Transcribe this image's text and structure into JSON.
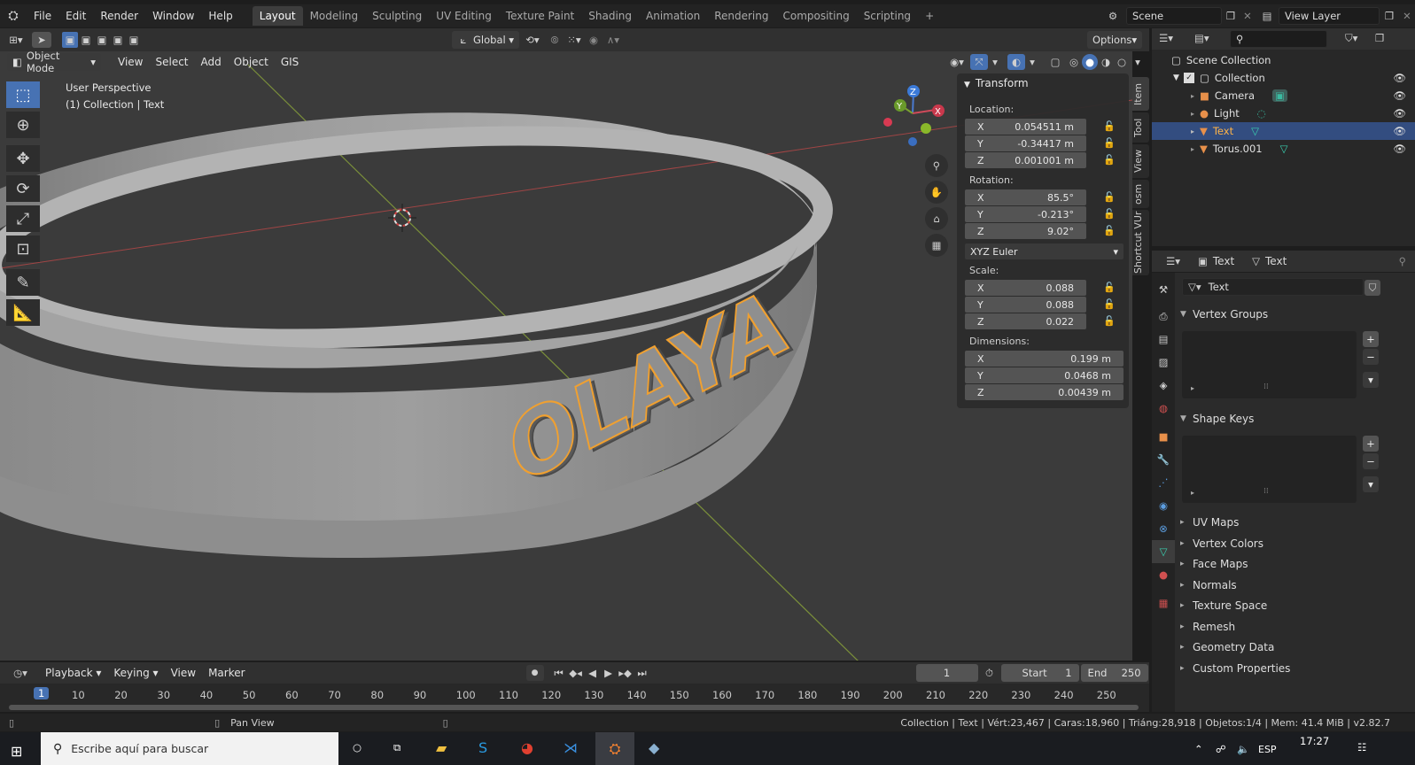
{
  "topbar": {
    "menus": [
      "File",
      "Edit",
      "Render",
      "Window",
      "Help"
    ],
    "workspaces": [
      "Layout",
      "Modeling",
      "Sculpting",
      "UV Editing",
      "Texture Paint",
      "Shading",
      "Animation",
      "Rendering",
      "Compositing",
      "Scripting"
    ],
    "active_workspace": "Layout",
    "add_tab": "+",
    "scene": "Scene",
    "view_layer": "View Layer"
  },
  "viewport_header": {
    "orientation": "Global",
    "options": "Options",
    "mode": "Object Mode",
    "menus": [
      "View",
      "Select",
      "Add",
      "Object",
      "GIS"
    ]
  },
  "viewport": {
    "perspective": "User Perspective",
    "collection_info": "(1) Collection | Text",
    "object_text": "OLAYA",
    "gizmo": {
      "z": "Z",
      "y": "Y",
      "x": "X"
    }
  },
  "npanel": {
    "title": "Transform",
    "location_label": "Location:",
    "location": [
      {
        "axis": "X",
        "value": "0.054511 m"
      },
      {
        "axis": "Y",
        "value": "-0.34417 m"
      },
      {
        "axis": "Z",
        "value": "0.001001 m"
      }
    ],
    "rotation_label": "Rotation:",
    "rotation": [
      {
        "axis": "X",
        "value": "85.5°"
      },
      {
        "axis": "Y",
        "value": "-0.213°"
      },
      {
        "axis": "Z",
        "value": "9.02°"
      }
    ],
    "rotation_mode": "XYZ Euler",
    "scale_label": "Scale:",
    "scale": [
      {
        "axis": "X",
        "value": "0.088"
      },
      {
        "axis": "Y",
        "value": "0.088"
      },
      {
        "axis": "Z",
        "value": "0.022"
      }
    ],
    "dimensions_label": "Dimensions:",
    "dimensions": [
      {
        "axis": "X",
        "value": "0.199 m"
      },
      {
        "axis": "Y",
        "value": "0.0468 m"
      },
      {
        "axis": "Z",
        "value": "0.00439 m"
      }
    ],
    "tabs": [
      "Item",
      "Tool",
      "View",
      "osm",
      "Shortcut VUr"
    ]
  },
  "outliner": {
    "root": "Scene Collection",
    "collection": "Collection",
    "items": [
      {
        "name": "Camera",
        "selected": false
      },
      {
        "name": "Light",
        "selected": false
      },
      {
        "name": "Text",
        "selected": true
      },
      {
        "name": "Torus.001",
        "selected": false
      }
    ]
  },
  "properties": {
    "breadcrumb_object": "Text",
    "breadcrumb_data": "Text",
    "data_name": "Text",
    "sections": [
      {
        "name": "Vertex Groups",
        "open": true
      },
      {
        "name": "Shape Keys",
        "open": true
      },
      {
        "name": "UV Maps",
        "open": false
      },
      {
        "name": "Vertex Colors",
        "open": false
      },
      {
        "name": "Face Maps",
        "open": false
      },
      {
        "name": "Normals",
        "open": false
      },
      {
        "name": "Texture Space",
        "open": false
      },
      {
        "name": "Remesh",
        "open": false
      },
      {
        "name": "Geometry Data",
        "open": false
      },
      {
        "name": "Custom Properties",
        "open": false
      }
    ]
  },
  "timeline": {
    "menus": [
      "Playback",
      "Keying",
      "View",
      "Marker"
    ],
    "current_frame": "1",
    "start_label": "Start",
    "start": "1",
    "end_label": "End",
    "end": "250",
    "ticks": [
      "1",
      "10",
      "20",
      "30",
      "40",
      "50",
      "60",
      "70",
      "80",
      "90",
      "100",
      "110",
      "120",
      "130",
      "140",
      "150",
      "160",
      "170",
      "180",
      "190",
      "200",
      "210",
      "220",
      "230",
      "240",
      "250"
    ]
  },
  "status": {
    "hint": "Pan View",
    "stats": "Collection | Text | Vért:23,467 | Caras:18,960 | Triáng:28,918 | Objetos:1/4 | Mem: 41.4 MiB | v2.82.7"
  },
  "taskbar": {
    "search_placeholder": "Escribe aquí para buscar",
    "lang": "ESP",
    "time": "17:27"
  },
  "colors": {
    "accent": "#4772b3",
    "selection_orange": "#f0a030",
    "viewport_bg": "#3b3b3b"
  }
}
